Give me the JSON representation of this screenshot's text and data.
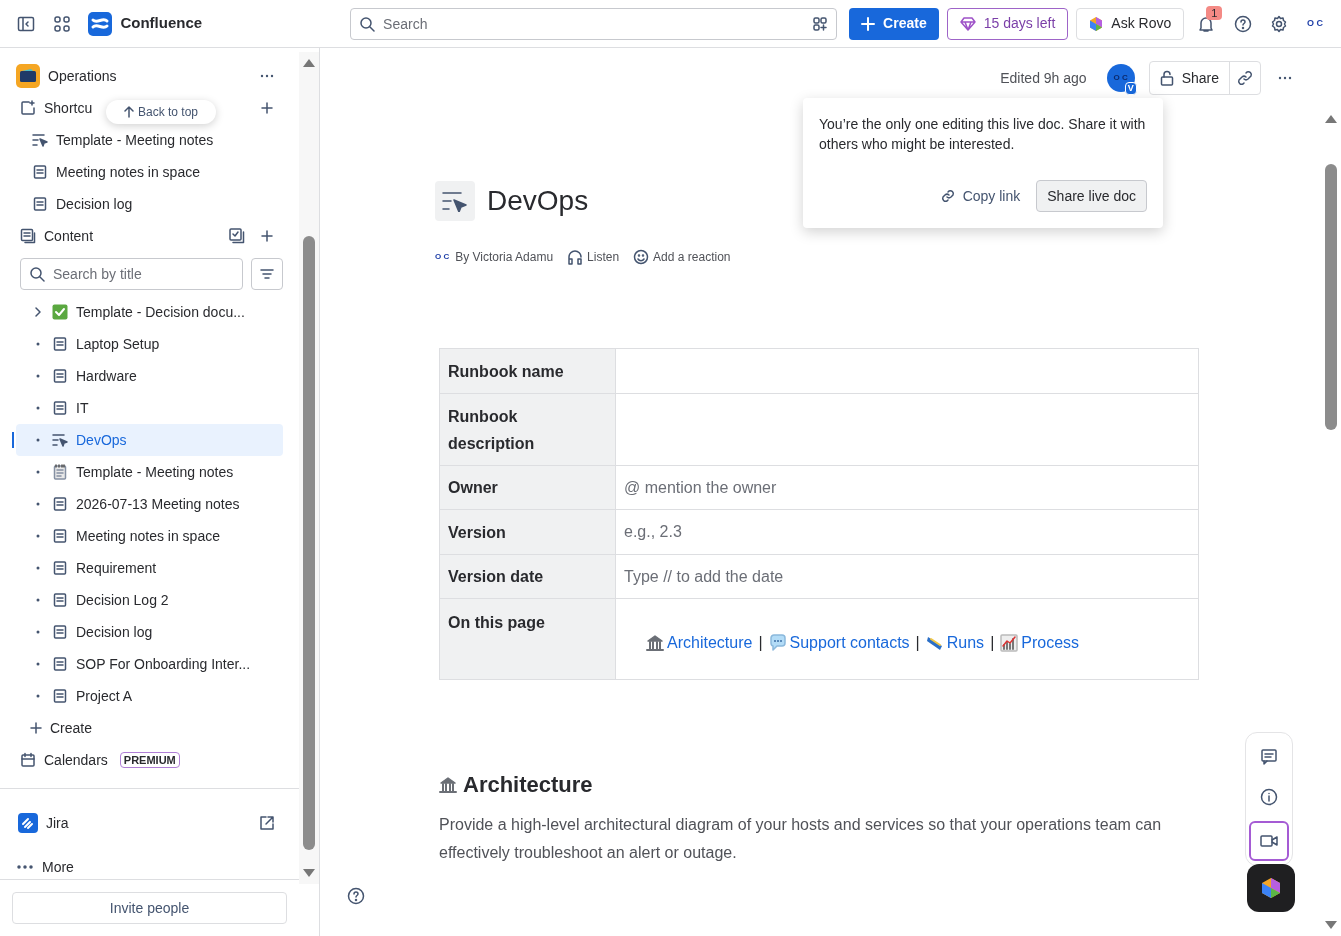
{
  "topbar": {
    "product": "Confluence",
    "search_placeholder": "Search",
    "create": "Create",
    "trial": "15 days left",
    "ask": "Ask Rovo",
    "notifications": "1",
    "avatar": "O C"
  },
  "sidebar": {
    "space": "Operations",
    "shortcuts_label": "Shortcu",
    "back_to_top": "Back to top",
    "shortcuts": [
      {
        "label": "Template - Meeting notes",
        "kind": "live"
      },
      {
        "label": "Meeting notes in space",
        "kind": "page"
      },
      {
        "label": "Decision log",
        "kind": "page"
      }
    ],
    "content_label": "Content",
    "content_search_placeholder": "Search by title",
    "tree": [
      {
        "label": "Template - Decision docu...",
        "kind": "decision",
        "expandable": true,
        "selected": false
      },
      {
        "label": "Laptop Setup",
        "kind": "page",
        "expandable": false,
        "selected": false
      },
      {
        "label": "Hardware",
        "kind": "page",
        "expandable": false,
        "selected": false
      },
      {
        "label": "IT",
        "kind": "page",
        "expandable": false,
        "selected": false
      },
      {
        "label": "DevOps",
        "kind": "live",
        "expandable": false,
        "selected": true
      },
      {
        "label": "Template - Meeting notes",
        "kind": "notes",
        "expandable": false,
        "selected": false
      },
      {
        "label": "2026-07-13 Meeting notes",
        "kind": "page",
        "expandable": false,
        "selected": false
      },
      {
        "label": "Meeting notes in space",
        "kind": "page",
        "expandable": false,
        "selected": false
      },
      {
        "label": "Requirement",
        "kind": "page",
        "expandable": false,
        "selected": false
      },
      {
        "label": "Decision Log 2",
        "kind": "page",
        "expandable": false,
        "selected": false
      },
      {
        "label": "Decision log",
        "kind": "page",
        "expandable": false,
        "selected": false
      },
      {
        "label": "SOP For Onboarding Inter...",
        "kind": "page",
        "expandable": false,
        "selected": false
      },
      {
        "label": "Project A",
        "kind": "page",
        "expandable": false,
        "selected": false
      }
    ],
    "create": "Create",
    "calendars": "Calendars",
    "calendars_badge": "PREMIUM",
    "jira": "Jira",
    "more": "More",
    "invite": "Invite people"
  },
  "page": {
    "edited": "Edited 9h ago",
    "avatar": "O C",
    "avatar_badge": "V",
    "share": "Share",
    "popup": {
      "message": "You’re the only one editing this live doc. Share it with others who might be interested.",
      "copy_link": "Copy link",
      "share_live": "Share live doc"
    },
    "title": "DevOps",
    "byline_logo": "O C",
    "byline": "By Victoria Adamu",
    "listen": "Listen",
    "reaction": "Add a reaction",
    "table": [
      {
        "label": "Runbook name"
      },
      {
        "label": "Runbook description"
      },
      {
        "label": "Owner",
        "kind": "placeholder",
        "value": "@ mention the owner"
      },
      {
        "label": "Version",
        "kind": "placeholder",
        "value": "e.g., 2.3"
      },
      {
        "label": "Version date",
        "kind": "placeholder",
        "value": "Type // to add the date"
      },
      {
        "label": "On this page",
        "kind": "links",
        "links": [
          {
            "label": "Architecture",
            "kind": "building"
          },
          {
            "label": "Support contacts",
            "kind": "speech"
          },
          {
            "label": "Runs",
            "kind": "sash"
          },
          {
            "label": "Process",
            "kind": "chart"
          }
        ],
        "separators": [
          "|",
          "|",
          "|"
        ]
      }
    ],
    "section": {
      "heading": "Architecture",
      "body": "Provide a high-level architectural diagram of your hosts and services so that your operations team can effectively troubleshoot an alert or outage."
    }
  }
}
